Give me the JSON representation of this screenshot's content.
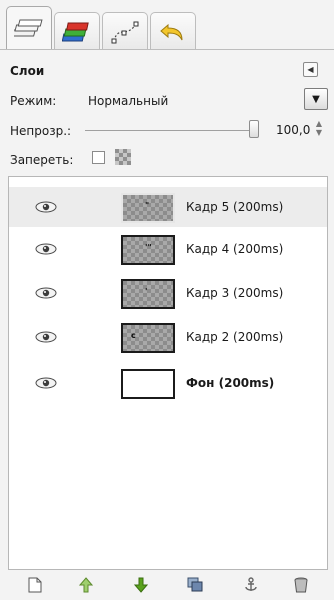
{
  "tabs": [
    {
      "icon": "layers-icon"
    },
    {
      "icon": "channels-icon"
    },
    {
      "icon": "paths-icon"
    },
    {
      "icon": "undo-history-icon"
    }
  ],
  "panel": {
    "title": "Слои",
    "collapse_icon": "triangle-left-icon"
  },
  "mode": {
    "label": "Режим:",
    "value": "Нормальный",
    "dropdown_icon": "triangle-down-icon"
  },
  "opacity": {
    "label": "Непрозр.:",
    "value": "100,0",
    "level": 1.0
  },
  "lock": {
    "label": "Запереть:",
    "checked": false,
    "alpha_icon": "checker-icon"
  },
  "layers": [
    {
      "name": "Кадр 5 (200ms)",
      "mark": "\"",
      "selected": true,
      "visible": true
    },
    {
      "name": "Кадр 4 (200ms)",
      "mark": "'\"",
      "selected": false,
      "visible": true
    },
    {
      "name": "Кадр 3 (200ms)",
      "mark": "'",
      "selected": false,
      "visible": true
    },
    {
      "name": "Кадр 2 (200ms)",
      "mark": "c",
      "selected": false,
      "visible": true
    },
    {
      "name": "Фон (200ms)",
      "mark": "",
      "selected": false,
      "visible": true,
      "bold": true
    }
  ],
  "bottom_buttons": [
    {
      "icon": "new-layer-icon"
    },
    {
      "icon": "raise-layer-icon"
    },
    {
      "icon": "lower-layer-icon"
    },
    {
      "icon": "duplicate-layer-icon"
    },
    {
      "icon": "anchor-icon"
    },
    {
      "icon": "trash-icon"
    }
  ],
  "colors": {
    "accent_green": "#5aa21d",
    "selected_row": "#ececec"
  }
}
